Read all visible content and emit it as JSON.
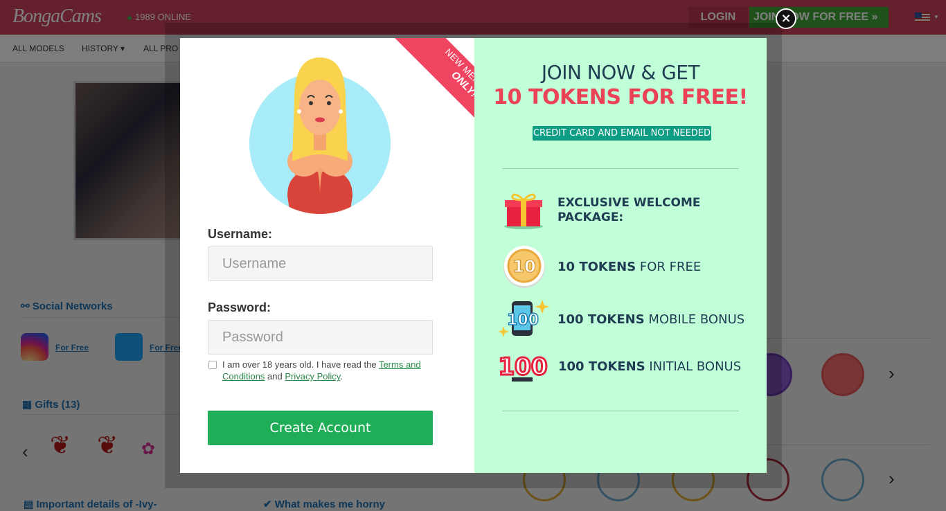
{
  "site": {
    "logo": "BongaCams",
    "online_count": "1989 ONLINE",
    "login_label": "LOGIN",
    "join_label": "JOIN NOW FOR FREE »",
    "nav": [
      "ALL MODELS",
      "HISTORY ▾",
      "ALL PRO"
    ],
    "social_heading": "Social Networks",
    "social_link_1": "For Free",
    "social_link_2": "For Free",
    "gifts_heading": "Gifts (13)",
    "details_heading": "Important details of -Ivy-",
    "horny_heading": "What makes me horny"
  },
  "modal": {
    "ribbon_line1": "NEW MEMBERS",
    "ribbon_line2": "ONLY!",
    "username_label": "Username:",
    "username_placeholder": "Username",
    "password_label": "Password:",
    "password_placeholder": "Password",
    "terms_text": "I am over 18 years old. I have read the ",
    "terms_link": "Terms and Conditions",
    "terms_and": " and ",
    "privacy_link": "Privacy Policy",
    "terms_end": ".",
    "create_button": "Create Account",
    "close_glyph": "×",
    "promo_line1": "JOIN NOW & GET",
    "promo_line2": "10 TOKENS FOR FREE!",
    "promo_badge": "CREDIT CARD AND EMAIL NOT NEEDED",
    "benefits": [
      {
        "icon": "gift-icon",
        "bold": "EXCLUSIVE WELCOME PACKAGE:",
        "rest": ""
      },
      {
        "icon": "coin-10-icon",
        "bold": "10 TOKENS",
        "rest": " FOR FREE"
      },
      {
        "icon": "mobile-100-icon",
        "bold": "100 TOKENS",
        "rest": " MOBILE BONUS"
      },
      {
        "icon": "100-tokens-icon",
        "bold": "100 TOKENS",
        "rest": " INITIAL BONUS"
      }
    ],
    "coin_label": "10",
    "mobile_label": "100",
    "initial_label": "100"
  },
  "colors": {
    "brand": "#c8405a",
    "promo_bg": "#c1ffd9",
    "accent_pink": "#ec4258",
    "button_green": "#20ad58",
    "badge_teal": "#0d9d84"
  }
}
